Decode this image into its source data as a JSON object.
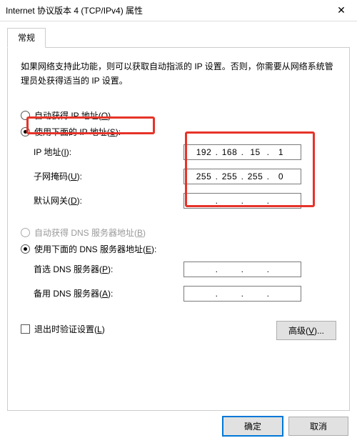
{
  "title": "Internet 协议版本 4 (TCP/IPv4) 属性",
  "close_glyph": "✕",
  "tab_general": "常规",
  "description": "如果网络支持此功能，则可以获取自动指派的 IP 设置。否则，你需要从网络系统管理员处获得适当的 IP 设置。",
  "radio": {
    "auto_ip": "自动获得 IP 地址(",
    "auto_ip_u": "O",
    "auto_ip_tail": ")",
    "manual_ip": "使用下面的 IP 地址(",
    "manual_ip_u": "S",
    "manual_ip_tail": "):",
    "auto_dns": "自动获得 DNS 服务器地址(",
    "auto_dns_u": "B",
    "auto_dns_tail": ")",
    "manual_dns": "使用下面的 DNS 服务器地址(",
    "manual_dns_u": "E",
    "manual_dns_tail": "):"
  },
  "labels": {
    "ip_addr": "IP 地址(",
    "ip_addr_u": "I",
    "ip_addr_tail": "):",
    "subnet": "子网掩码(",
    "subnet_u": "U",
    "subnet_tail": "):",
    "gateway": "默认网关(",
    "gateway_u": "D",
    "gateway_tail": "):",
    "dns1": "首选 DNS 服务器(",
    "dns1_u": "P",
    "dns1_tail": "):",
    "dns2": "备用 DNS 服务器(",
    "dns2_u": "A",
    "dns2_tail": "):"
  },
  "values": {
    "ip": [
      "192",
      "168",
      "15",
      "1"
    ],
    "subnet": [
      "255",
      "255",
      "255",
      "0"
    ],
    "gateway": [
      "",
      "",
      "",
      ""
    ],
    "dns1": [
      "",
      "",
      "",
      ""
    ],
    "dns2": [
      "",
      "",
      "",
      ""
    ]
  },
  "dot": ".",
  "validate_exit": "退出时验证设置(",
  "validate_exit_u": "L",
  "validate_exit_tail": ")",
  "advanced": "高级(",
  "advanced_u": "V",
  "advanced_tail": ")...",
  "ok": "确定",
  "cancel": "取消"
}
